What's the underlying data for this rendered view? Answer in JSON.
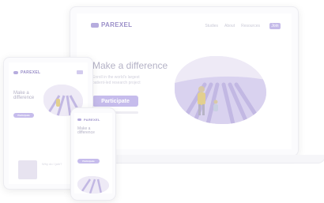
{
  "desktop": {
    "logo": "PAREXEL",
    "nav": [
      "Studies",
      "About",
      "Resources"
    ],
    "nav_button": "Join",
    "headline": "Make a difference",
    "subtext": [
      "Enroll in the world's largest",
      "patient-led research project"
    ],
    "cta": "Participate"
  },
  "tablet": {
    "logo": "PAREXEL",
    "headline": [
      "Make a",
      "difference"
    ],
    "cta": "Participate",
    "card_text": "Why do I join?"
  },
  "mobile": {
    "logo": "PAREXEL",
    "headline": [
      "Make a",
      "difference"
    ],
    "cta": "Participate"
  },
  "colors": {
    "accent": "#c6bcec",
    "brand": "#9a8fc8",
    "lavender": "#c9c1e6",
    "sky": "#e9e5f4"
  }
}
